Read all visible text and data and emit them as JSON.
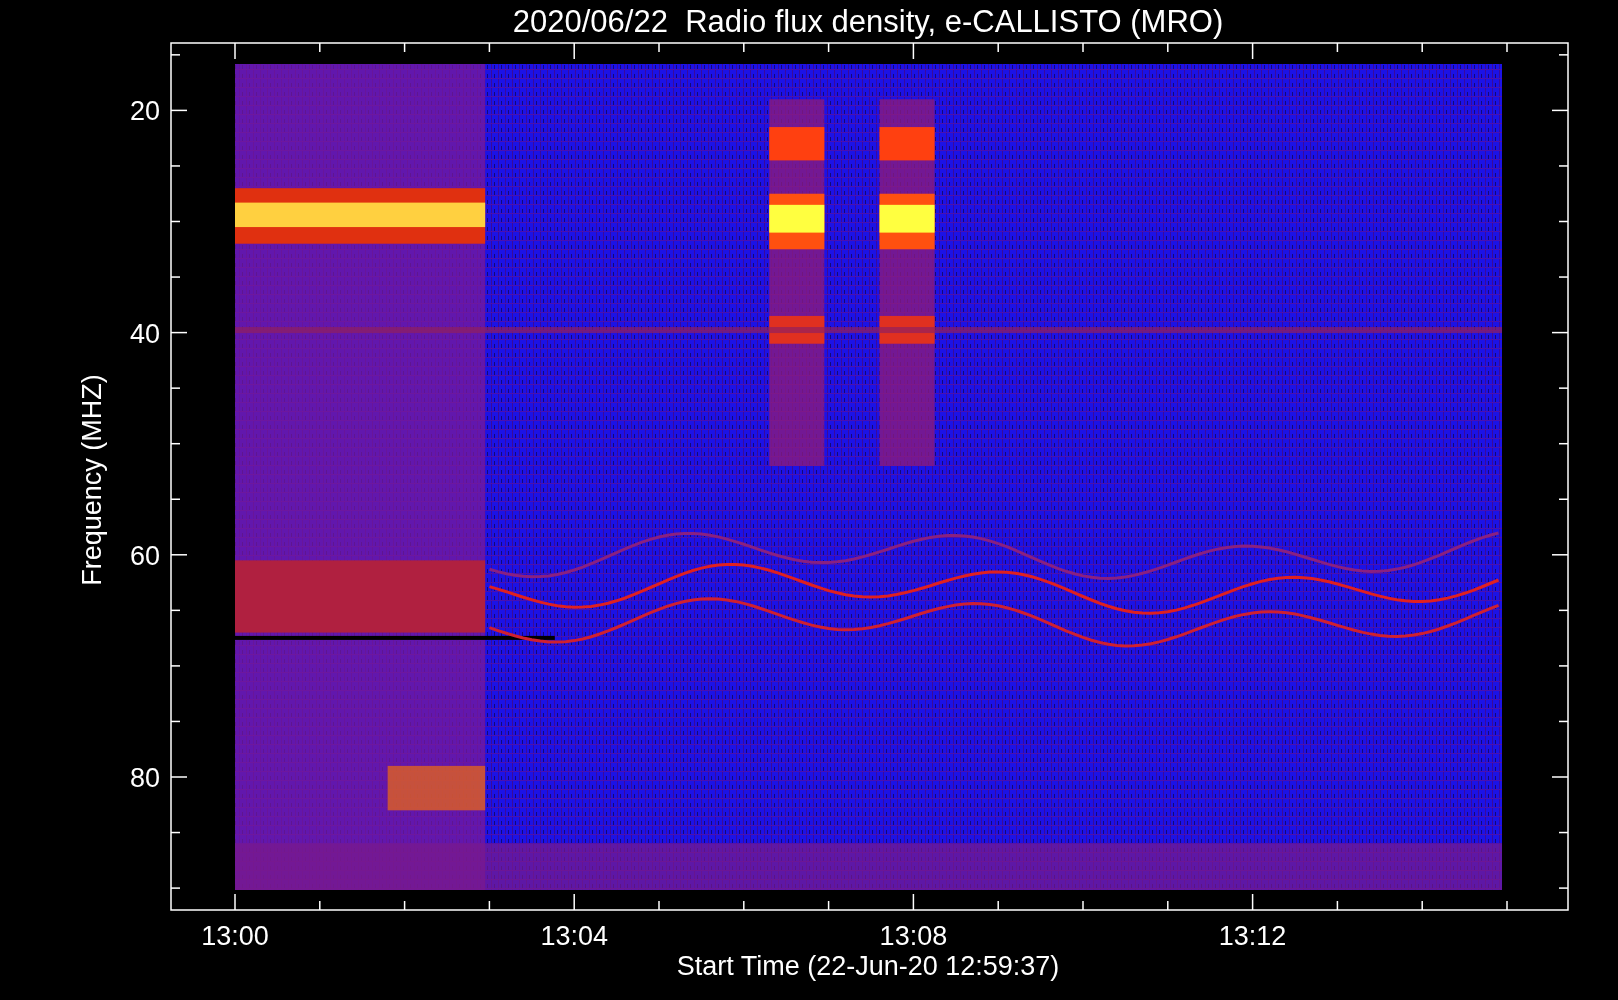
{
  "title": "2020/06/22  Radio flux density, e-CALLISTO (MRO)",
  "y_axis": {
    "label": "Frequency (MHZ)",
    "ticks": [
      "20",
      "40",
      "60",
      "80"
    ]
  },
  "x_axis": {
    "label": "Start Time (22-Jun-20 12:59:37)",
    "ticks": [
      "13:00",
      "13:04",
      "13:08",
      "13:12"
    ]
  }
}
